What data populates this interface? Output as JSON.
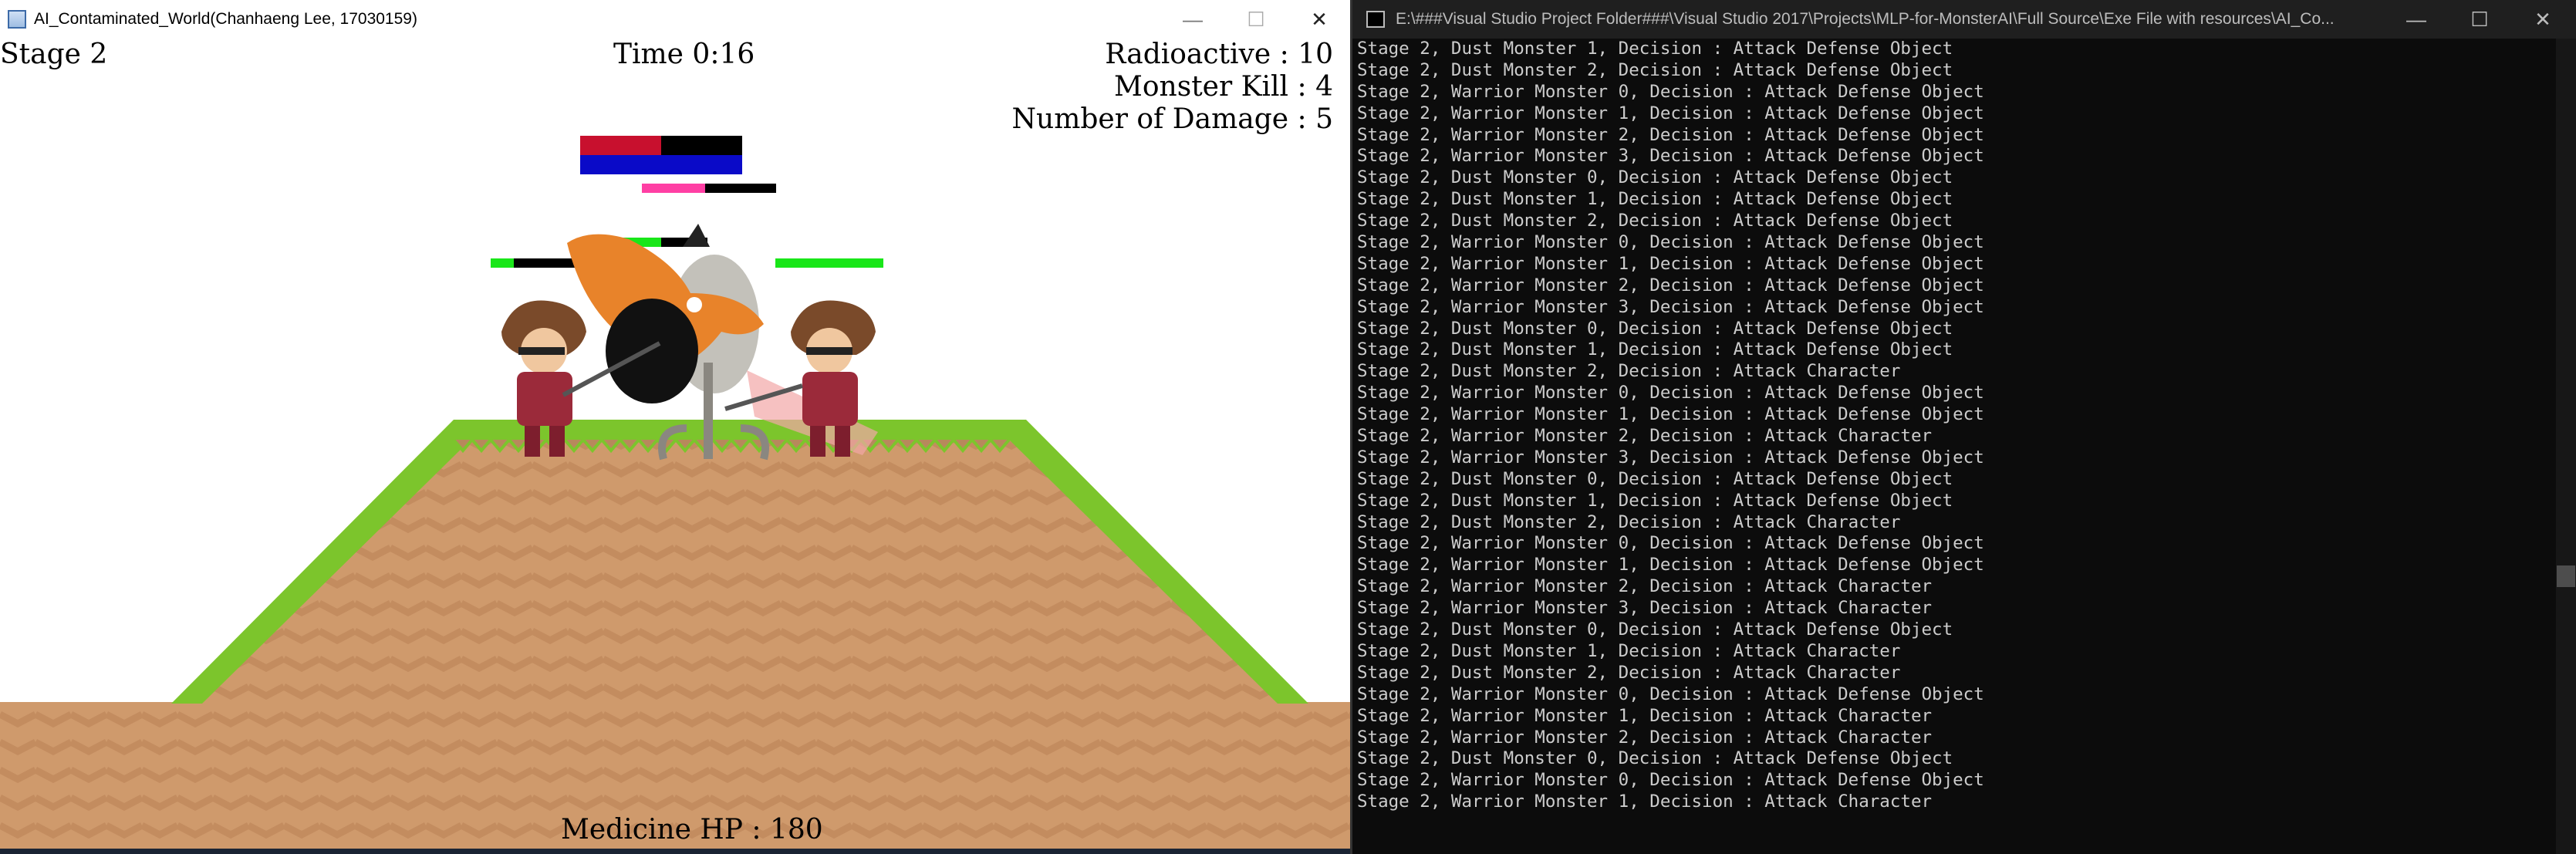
{
  "game_window": {
    "title": "AI_Contaminated_World(Chanhaeng Lee, 17030159)",
    "controls": {
      "minimize": "—",
      "maximize": "☐",
      "close": "✕"
    }
  },
  "hud": {
    "stage": "Stage 2",
    "time": "Time 0:16",
    "radioactive": "Radioactive : 10",
    "monster_kill": "Monster Kill : 4",
    "damage": "Number of Damage : 5",
    "medicine_hp": "Medicine HP : 180"
  },
  "colors": {
    "grass": "#7cc52c",
    "dirt": "#cf9a6c",
    "hp_green": "#19e619",
    "bar_blue": "#0a0ac8",
    "bar_red": "#c8102e",
    "bar_pink": "#ff3fa4"
  },
  "console_window": {
    "title": "E:\\###Visual Studio Project Folder###\\Visual Studio 2017\\Projects\\MLP-for-MonsterAI\\Full Source\\Exe File with resources\\AI_Co...",
    "controls": {
      "minimize": "—",
      "maximize": "☐",
      "close": "✕"
    },
    "lines": [
      "Stage 2, Dust Monster 1, Decision : Attack Defense Object",
      "Stage 2, Dust Monster 2, Decision : Attack Defense Object",
      "Stage 2, Warrior Monster 0, Decision : Attack Defense Object",
      "Stage 2, Warrior Monster 1, Decision : Attack Defense Object",
      "Stage 2, Warrior Monster 2, Decision : Attack Defense Object",
      "Stage 2, Warrior Monster 3, Decision : Attack Defense Object",
      "Stage 2, Dust Monster 0, Decision : Attack Defense Object",
      "Stage 2, Dust Monster 1, Decision : Attack Defense Object",
      "Stage 2, Dust Monster 2, Decision : Attack Defense Object",
      "Stage 2, Warrior Monster 0, Decision : Attack Defense Object",
      "Stage 2, Warrior Monster 1, Decision : Attack Defense Object",
      "Stage 2, Warrior Monster 2, Decision : Attack Defense Object",
      "Stage 2, Warrior Monster 3, Decision : Attack Defense Object",
      "Stage 2, Dust Monster 0, Decision : Attack Defense Object",
      "Stage 2, Dust Monster 1, Decision : Attack Defense Object",
      "Stage 2, Dust Monster 2, Decision : Attack Character",
      "Stage 2, Warrior Monster 0, Decision : Attack Defense Object",
      "Stage 2, Warrior Monster 1, Decision : Attack Defense Object",
      "Stage 2, Warrior Monster 2, Decision : Attack Character",
      "Stage 2, Warrior Monster 3, Decision : Attack Defense Object",
      "Stage 2, Dust Monster 0, Decision : Attack Defense Object",
      "Stage 2, Dust Monster 1, Decision : Attack Defense Object",
      "Stage 2, Dust Monster 2, Decision : Attack Character",
      "Stage 2, Warrior Monster 0, Decision : Attack Defense Object",
      "Stage 2, Warrior Monster 1, Decision : Attack Defense Object",
      "Stage 2, Warrior Monster 2, Decision : Attack Character",
      "Stage 2, Warrior Monster 3, Decision : Attack Character",
      "Stage 2, Dust Monster 0, Decision : Attack Defense Object",
      "Stage 2, Dust Monster 1, Decision : Attack Character",
      "Stage 2, Dust Monster 2, Decision : Attack Character",
      "Stage 2, Warrior Monster 0, Decision : Attack Defense Object",
      "Stage 2, Warrior Monster 1, Decision : Attack Character",
      "Stage 2, Warrior Monster 2, Decision : Attack Character",
      "Stage 2, Dust Monster 0, Decision : Attack Defense Object",
      "Stage 2, Warrior Monster 0, Decision : Attack Defense Object",
      "Stage 2, Warrior Monster 1, Decision : Attack Character"
    ]
  }
}
